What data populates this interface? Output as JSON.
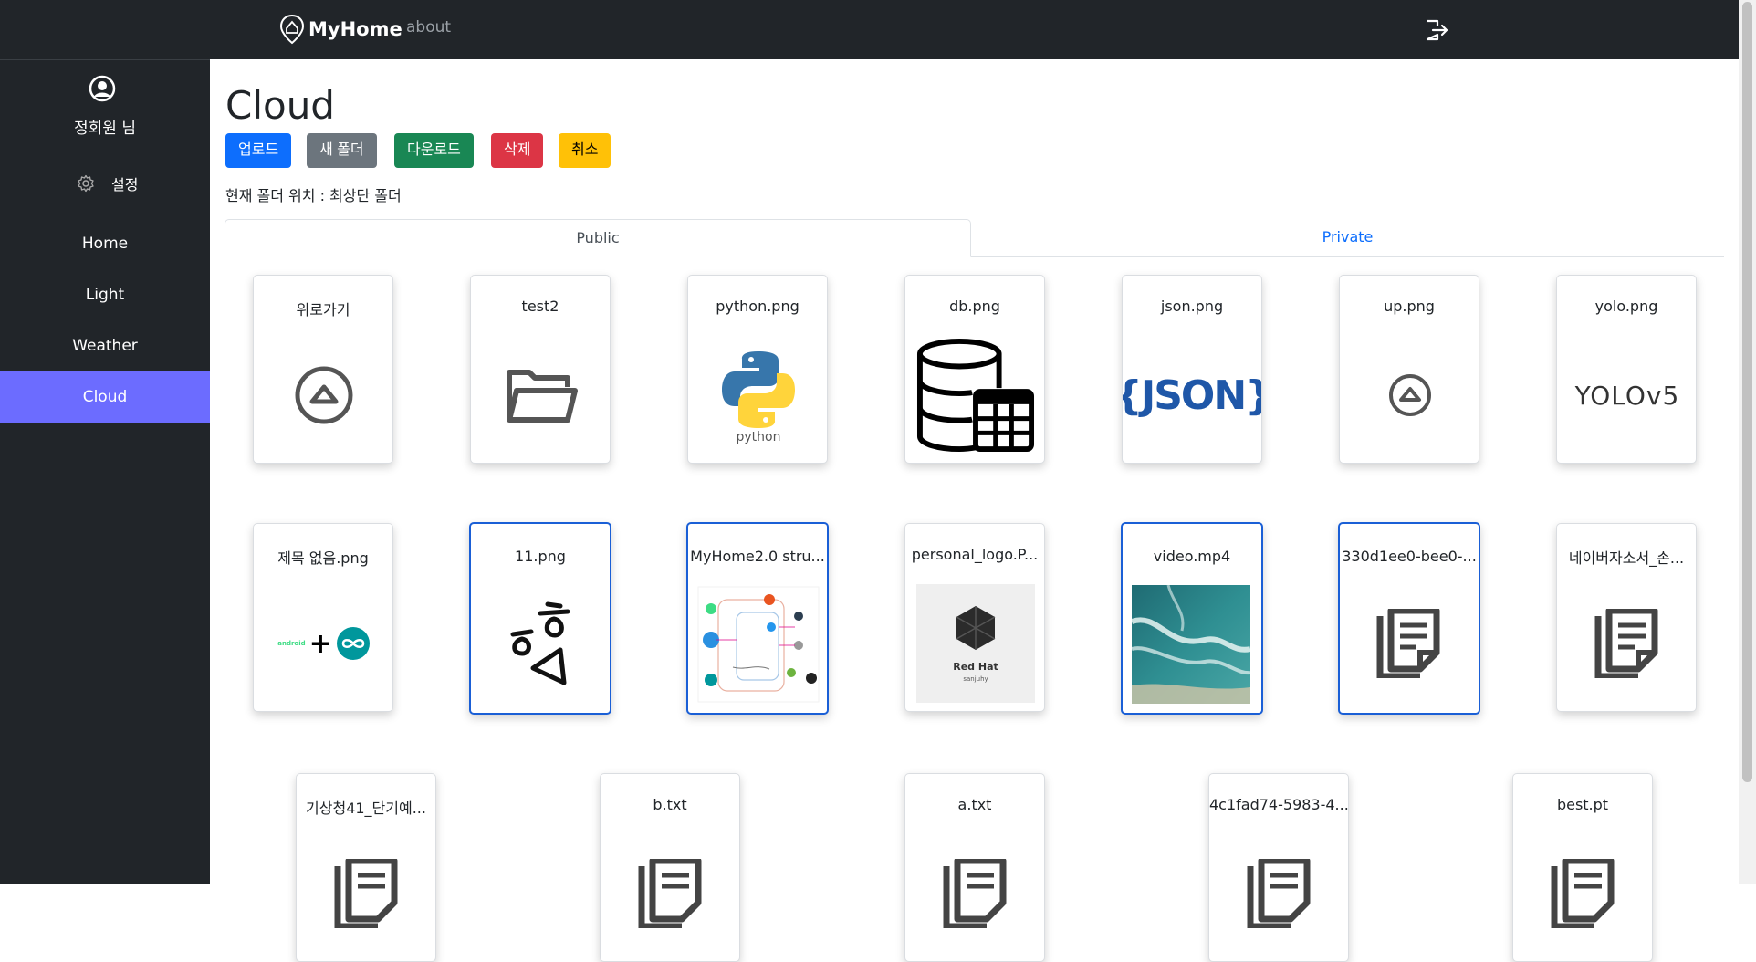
{
  "header": {
    "brand": "MyHome",
    "about": "about"
  },
  "sidebar": {
    "user_name": "정회원 님",
    "settings_label": "설정",
    "items": [
      {
        "label": "Home",
        "active": false
      },
      {
        "label": "Light",
        "active": false
      },
      {
        "label": "Weather",
        "active": false
      },
      {
        "label": "Cloud",
        "active": true
      }
    ]
  },
  "main": {
    "title": "Cloud",
    "buttons": {
      "upload": "업로드",
      "new_folder": "새 폴더",
      "download": "다운로드",
      "delete": "삭제",
      "cancel": "취소"
    },
    "location": "현재 폴더 위치 : 최상단 폴더",
    "tabs": {
      "public": "Public",
      "private": "Private"
    }
  },
  "files": [
    {
      "name": "위로가기",
      "icon": "up-circle-icon",
      "selected": false
    },
    {
      "name": "test2",
      "icon": "folder-open-icon",
      "selected": false
    },
    {
      "name": "python.png",
      "icon": "python-logo-icon",
      "selected": false,
      "caption": "python"
    },
    {
      "name": "db.png",
      "icon": "database-table-icon",
      "selected": false
    },
    {
      "name": "json.png",
      "icon": "json-icon",
      "selected": false,
      "caption": "{JSON}"
    },
    {
      "name": "up.png",
      "icon": "up-circle-icon",
      "selected": false
    },
    {
      "name": "yolo.png",
      "icon": "yolov5-logo",
      "selected": false,
      "caption": "YOLOv5"
    },
    {
      "name": "제목 없음.png",
      "icon": "android-arduino-image",
      "selected": false,
      "caption": "android"
    },
    {
      "name": "11.png",
      "icon": "handwriting-image",
      "selected": true
    },
    {
      "name": "MyHome2.0 stru...",
      "icon": "diagram-image",
      "selected": true
    },
    {
      "name": "personal_logo.P...",
      "icon": "redhat-logo-image",
      "selected": false,
      "caption": "Red Hat",
      "subcaption": "sanjuhy"
    },
    {
      "name": "video.mp4",
      "icon": "ocean-video-thumbnail",
      "selected": true
    },
    {
      "name": "330d1ee0-bee0-...",
      "icon": "document-icon",
      "selected": true
    },
    {
      "name": "네이버자소서_손...",
      "icon": "document-icon",
      "selected": false
    },
    {
      "name": "기상청41_단기예...",
      "icon": "document-icon",
      "selected": false
    },
    {
      "name": "b.txt",
      "icon": "document-icon",
      "selected": false
    },
    {
      "name": "a.txt",
      "icon": "document-icon",
      "selected": false
    },
    {
      "name": "4c1fad74-5983-4...",
      "icon": "document-icon",
      "selected": false
    },
    {
      "name": "best.pt",
      "icon": "document-icon",
      "selected": false
    }
  ]
}
